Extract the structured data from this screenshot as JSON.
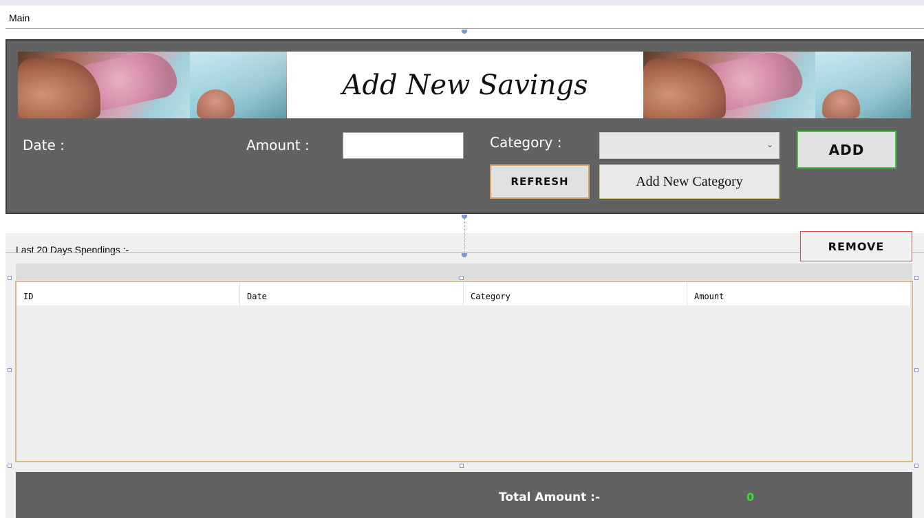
{
  "window": {
    "title": "Main"
  },
  "banner": {
    "heading": "Add New Savings"
  },
  "form": {
    "date_label": "Date :",
    "amount_label": "Amount :",
    "amount_value": "",
    "category_label": "Category :",
    "category_selected": "",
    "add_button": "ADD",
    "refresh_button": "REFRESH",
    "add_category_button": "Add New Category"
  },
  "list": {
    "heading": "Last 20 Days Spendings :-",
    "remove_button": "REMOVE",
    "columns": [
      "ID",
      "Date",
      "Category",
      "Amount"
    ],
    "rows": []
  },
  "footer": {
    "total_label": "Total Amount :-",
    "total_value": "0"
  },
  "colors": {
    "panel": "#626262",
    "add_border": "#47c447",
    "refresh_border": "#d9a36a",
    "remove_border": "#d94a4a",
    "total_value": "#33e133"
  }
}
